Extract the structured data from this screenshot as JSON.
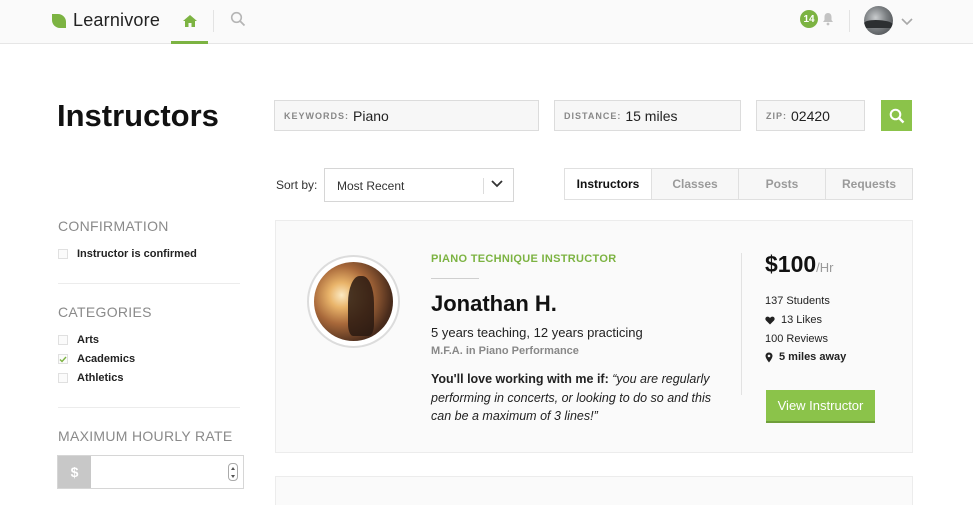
{
  "app": {
    "name": "Learnivore",
    "notification_count": "14"
  },
  "page": {
    "title": "Instructors"
  },
  "search": {
    "keywords": {
      "label": "KEYWORDS:",
      "value": "Piano"
    },
    "distance": {
      "label": "DISTANCE:",
      "value": "15 miles"
    },
    "zip": {
      "label": "ZIP:",
      "value": "02420"
    }
  },
  "sort": {
    "label": "Sort by:",
    "selected": "Most Recent"
  },
  "tabs": [
    {
      "label": "Instructors",
      "active": true
    },
    {
      "label": "Classes",
      "active": false
    },
    {
      "label": "Posts",
      "active": false
    },
    {
      "label": "Requests",
      "active": false
    }
  ],
  "sidebar": {
    "confirmation": {
      "heading": "CONFIRMATION",
      "items": [
        {
          "label": "Instructor is confirmed",
          "checked": false
        }
      ]
    },
    "categories": {
      "heading": "CATEGORIES",
      "items": [
        {
          "label": "Arts",
          "checked": false
        },
        {
          "label": "Academics",
          "checked": true
        },
        {
          "label": "Athletics",
          "checked": false
        }
      ]
    },
    "rate": {
      "heading": "MAXIMUM HOURLY RATE",
      "prefix": "$",
      "value": ""
    }
  },
  "results": [
    {
      "category": "PIANO TECHNIQUE INSTRUCTOR",
      "name": "Jonathan H.",
      "experience": "5 years teaching, 12 years practicing",
      "degree": "M.F.A. in Piano Performance",
      "quote_lead": "You'll love working with me if:",
      "quote_text": "“you are regularly performing in concerts, or looking to do so and this can be a maximum of 3 lines!”",
      "price": "$100",
      "price_unit": "/Hr",
      "students": "137 Students",
      "likes": "13 Likes",
      "reviews": "100 Reviews",
      "distance": "5 miles away",
      "button": "View Instructor"
    }
  ],
  "colors": {
    "accent": "#8bc34a",
    "accent_text": "#7cb342"
  }
}
